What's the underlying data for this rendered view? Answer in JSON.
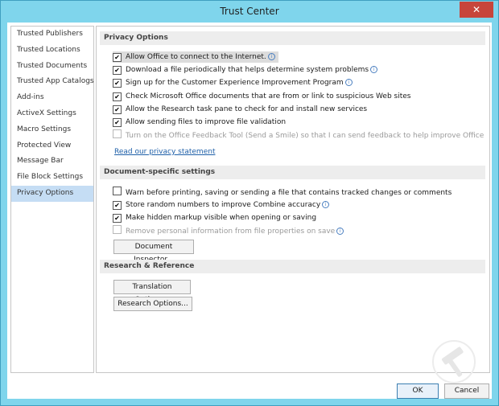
{
  "window": {
    "title": "Trust Center",
    "close_glyph": "✕"
  },
  "sidebar": {
    "items": [
      {
        "label": "Trusted Publishers",
        "active": false
      },
      {
        "label": "Trusted Locations",
        "active": false
      },
      {
        "label": "Trusted Documents",
        "active": false
      },
      {
        "label": "Trusted App Catalogs",
        "active": false
      },
      {
        "label": "Add-ins",
        "active": false
      },
      {
        "label": "ActiveX Settings",
        "active": false
      },
      {
        "label": "Macro Settings",
        "active": false
      },
      {
        "label": "Protected View",
        "active": false
      },
      {
        "label": "Message Bar",
        "active": false
      },
      {
        "label": "File Block Settings",
        "active": false
      },
      {
        "label": "Privacy Options",
        "active": true
      }
    ]
  },
  "privacy": {
    "header": "Privacy Options",
    "options": [
      {
        "label": "Allow Office to connect to the Internet.",
        "checked": true,
        "disabled": false,
        "info": true
      },
      {
        "label": "Download a file periodically that helps determine system problems",
        "checked": true,
        "disabled": false,
        "info": true
      },
      {
        "label": "Sign up for the Customer Experience Improvement Program",
        "checked": true,
        "disabled": false,
        "info": true
      },
      {
        "label": "Check Microsoft Office documents that are from or link to suspicious Web sites",
        "checked": true,
        "disabled": false,
        "info": false
      },
      {
        "label": "Allow the Research task pane to check for and install new services",
        "checked": true,
        "disabled": false,
        "info": false
      },
      {
        "label": "Allow sending files to improve file validation",
        "checked": true,
        "disabled": false,
        "info": false
      },
      {
        "label": "Turn on the Office Feedback Tool (Send a Smile) so that I can send feedback to help improve Office",
        "checked": false,
        "disabled": true,
        "info": false
      }
    ],
    "link": "Read our privacy statement"
  },
  "document_specific": {
    "header": "Document-specific settings",
    "options": [
      {
        "label": "Warn before printing, saving or sending a file that contains tracked changes or comments",
        "checked": false,
        "disabled": false,
        "info": false
      },
      {
        "label": "Store random numbers to improve Combine accuracy",
        "checked": true,
        "disabled": false,
        "info": true
      },
      {
        "label": "Make hidden markup visible when opening or saving",
        "checked": true,
        "disabled": false,
        "info": false
      },
      {
        "label": "Remove personal information from file properties on save",
        "checked": false,
        "disabled": true,
        "info": true
      }
    ],
    "inspector_button": "Document Inspector..."
  },
  "research": {
    "header": "Research & Reference",
    "translation_button": "Translation Options...",
    "research_button": "Research Options..."
  },
  "footer": {
    "ok_label": "OK",
    "cancel_label": "Cancel"
  },
  "icons": {
    "checkmark": "✔",
    "info": "i"
  },
  "colors": {
    "titlebar": "#7fd5ec",
    "close": "#c7453b",
    "selected": "#c5ddf4",
    "link": "#1e5fa8"
  }
}
